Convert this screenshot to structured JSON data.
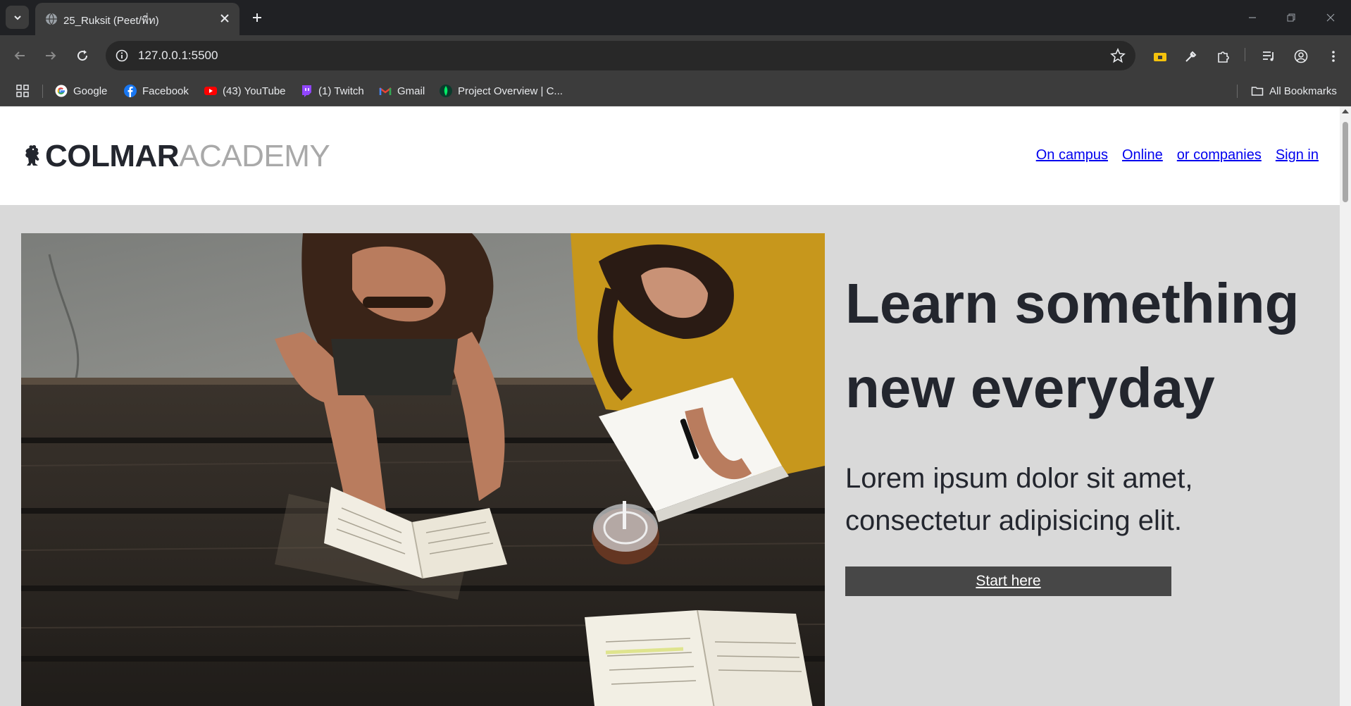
{
  "browser": {
    "tab_title": "25_Ruksit (Peet/พี่ท)",
    "url": "127.0.0.1:5500",
    "bookmarks": [
      {
        "label": "Google",
        "icon": "google-icon"
      },
      {
        "label": "Facebook",
        "icon": "facebook-icon"
      },
      {
        "label": "(43) YouTube",
        "icon": "youtube-icon"
      },
      {
        "label": "(1) Twitch",
        "icon": "twitch-icon"
      },
      {
        "label": "Gmail",
        "icon": "gmail-icon"
      },
      {
        "label": "Project Overview | C...",
        "icon": "mongodb-icon"
      }
    ],
    "all_bookmarks": "All Bookmarks"
  },
  "site": {
    "logo_primary": "COLMAR",
    "logo_secondary": "ACADEMY",
    "nav": [
      "On campus",
      "Online",
      "or companies",
      "Sign in"
    ],
    "hero": {
      "title": "Learn something new everyday",
      "subtitle": "Lorem ipsum dolor sit amet, consectetur adipisicing elit.",
      "cta": "Start here",
      "image": "Two students studying at a wooden table with open books and an iced drink"
    }
  },
  "colors": {
    "page_bg": "#d9d9d9",
    "header_bg": "#ffffff",
    "text_dark": "#23262e",
    "logo_grey": "#a9a9a9",
    "link": "#0000ee",
    "cta_bg": "#474747"
  }
}
